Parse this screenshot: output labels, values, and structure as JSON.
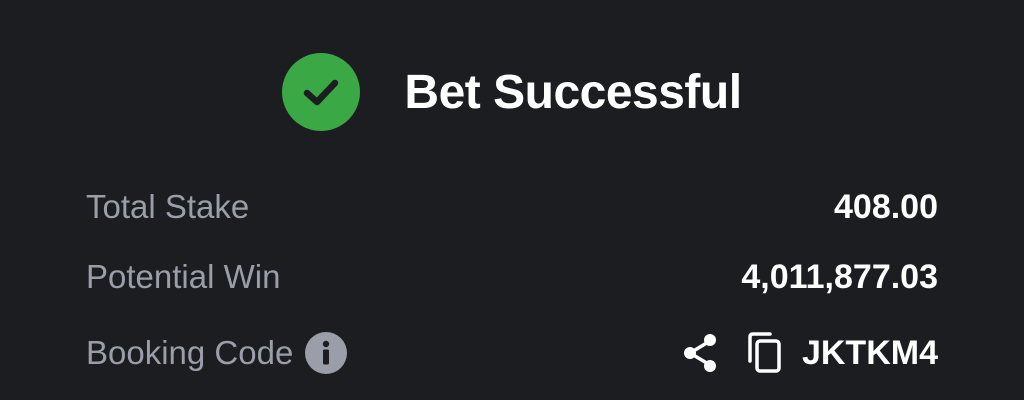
{
  "header": {
    "title": "Bet Successful",
    "icon": "check-circle-icon"
  },
  "summary": {
    "total_stake": {
      "label": "Total Stake",
      "value": "408.00"
    },
    "potential_win": {
      "label": "Potential Win",
      "value": "4,011,877.03"
    },
    "booking_code": {
      "label": "Booking Code",
      "value": "JKTKM4",
      "info_icon": "info-icon",
      "share_icon": "share-icon",
      "copy_icon": "copy-icon"
    }
  },
  "colors": {
    "background": "#1b1d21",
    "success_green": "#3aa845",
    "label_gray": "#9a9ea8",
    "value_white": "#ffffff"
  }
}
